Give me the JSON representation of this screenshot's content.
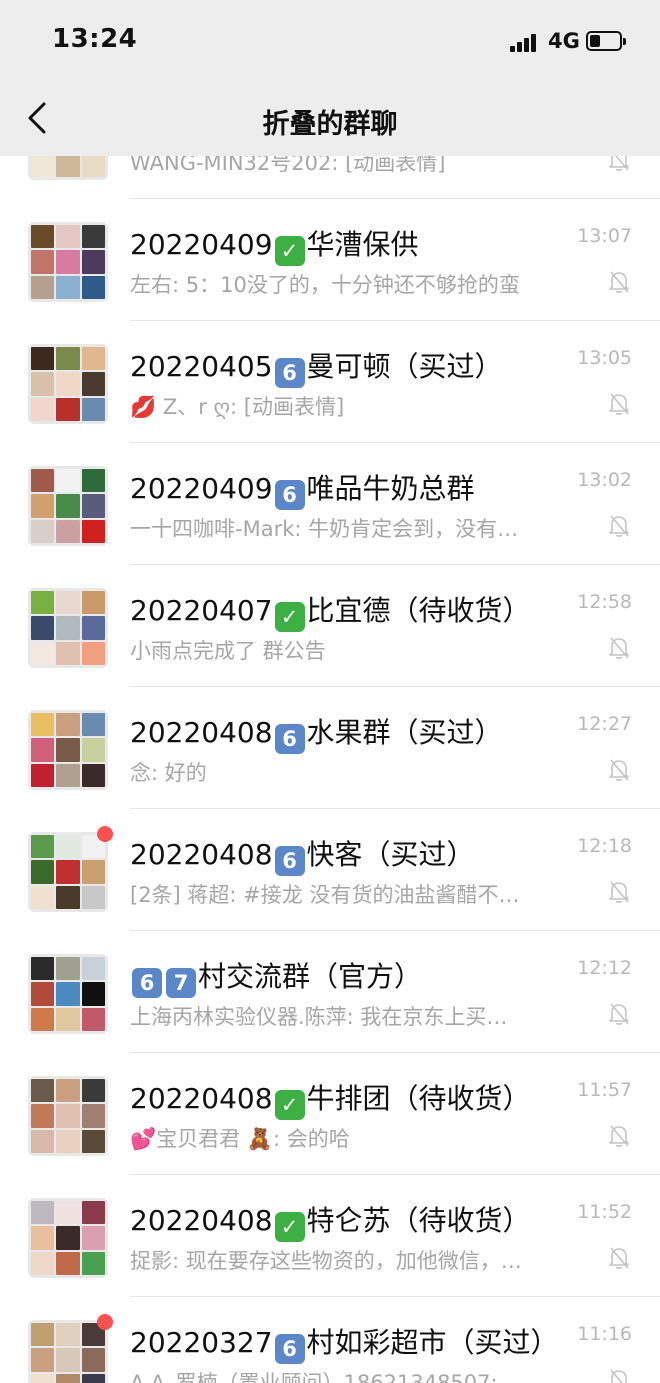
{
  "status_bar": {
    "time": "13:24",
    "network": "4G",
    "battery_level": 0.35
  },
  "nav": {
    "title": "折叠的群聊",
    "back_icon": "chevron-left-icon"
  },
  "colors": {
    "background": "#ffffff",
    "header": "#ededed",
    "check_badge": "#3cb043",
    "number_badge": "#5b86c8",
    "unread_dot": "#fa5151"
  },
  "chats": [
    {
      "title_pre": "",
      "badges": [],
      "title_post": "",
      "preview": "WANG-MIN32号202: [动画表情]",
      "time": "",
      "muted": true,
      "unread": false,
      "avatar_colors": [
        "#c9b89a",
        "#8a6a4a",
        "#d8a860",
        "#e2d4bf",
        "#b98756",
        "#ddbf8a",
        "#efe6d6",
        "#cdb89a",
        "#e8dcc5"
      ]
    },
    {
      "title_pre": "20220409",
      "badges": [
        "✓"
      ],
      "title_post": "华漕保供",
      "preview": "左右: 5：10没了的，十分钟还不够抢的蛮",
      "time": "13:07",
      "muted": true,
      "unread": false,
      "avatar_colors": [
        "#6b4a2a",
        "#e6c6c0",
        "#3a3a3a",
        "#c0746a",
        "#d67ca0",
        "#4b3b5c",
        "#b5a08d",
        "#8bb0d0",
        "#2d5c8a"
      ]
    },
    {
      "title_pre": "20220405",
      "badges": [
        "6"
      ],
      "title_post": "曼可顿（买过）",
      "preview": "💋 Z、r ღ: [动画表情]",
      "time": "13:05",
      "muted": true,
      "unread": false,
      "avatar_colors": [
        "#3d2a1e",
        "#7a8a4a",
        "#e0b890",
        "#d9c0a8",
        "#f0d8c8",
        "#4a3a30",
        "#f2d6cc",
        "#b8302a",
        "#6a8ab0"
      ]
    },
    {
      "title_pre": "20220409",
      "badges": [
        "6"
      ],
      "title_post": "唯品牛奶总群",
      "preview": "一十四咖啡-Mark: 牛奶肯定会到，没有…",
      "time": "13:02",
      "muted": true,
      "unread": false,
      "avatar_colors": [
        "#a05a4a",
        "#f2f2f2",
        "#2f6a3a",
        "#d0a070",
        "#4a8a4a",
        "#5a5a7a",
        "#d8d0c8",
        "#caa0a0",
        "#d02020"
      ]
    },
    {
      "title_pre": "20220407",
      "badges": [
        "✓"
      ],
      "title_post": "比宜德（待收货）",
      "preview": "小雨点完成了 群公告",
      "time": "12:58",
      "muted": true,
      "unread": false,
      "avatar_colors": [
        "#7ab040",
        "#e8d8d0",
        "#c89a6a",
        "#3a4a6a",
        "#b0b8c0",
        "#5a6a9a",
        "#f2e8e0",
        "#e0c0b0",
        "#f0a080"
      ]
    },
    {
      "title_pre": "20220408",
      "badges": [
        "6"
      ],
      "title_post": "水果群（买过）",
      "preview": "念: 好的",
      "time": "12:27",
      "muted": true,
      "unread": false,
      "avatar_colors": [
        "#e8c060",
        "#caa080",
        "#6a8ab0",
        "#d0607a",
        "#7a5a4a",
        "#c8d0a0",
        "#c02030",
        "#b0a090",
        "#3a2a2a"
      ]
    },
    {
      "title_pre": "20220408",
      "badges": [
        "6"
      ],
      "title_post": "快客（买过）",
      "preview": "[2条] 蒋超: #接龙 没有货的油盐酱醋不…",
      "time": "12:18",
      "muted": true,
      "unread": true,
      "avatar_colors": [
        "#5a9a4a",
        "#e0e8e0",
        "#f2f2f2",
        "#3a6a2a",
        "#c03030",
        "#caa070",
        "#f0e0d0",
        "#4a3a2a",
        "#c8c8c8"
      ]
    },
    {
      "title_pre": "",
      "badges": [
        "6",
        "7"
      ],
      "title_post": "村交流群（官方）",
      "preview": "上海丙林实验仪器.陈萍: 我在京东上买…",
      "time": "12:12",
      "muted": true,
      "unread": false,
      "avatar_colors": [
        "#2a2a2a",
        "#a0a090",
        "#c8d0d8",
        "#b04a3a",
        "#4a8ac0",
        "#101010",
        "#d07a4a",
        "#e0c8a0",
        "#c05a6a"
      ]
    },
    {
      "title_pre": "20220408",
      "badges": [
        "✓"
      ],
      "title_post": "牛排团（待收货）",
      "preview": "💕宝贝君君 🧸: 会的哈",
      "time": "11:57",
      "muted": true,
      "unread": false,
      "avatar_colors": [
        "#6a5a4a",
        "#caa080",
        "#3a3a3a",
        "#c07a5a",
        "#e0c0b0",
        "#a08070",
        "#d8b8a8",
        "#e8d0c0",
        "#5a4a3a"
      ]
    },
    {
      "title_pre": "20220408",
      "badges": [
        "✓"
      ],
      "title_post": "特仑苏（待收货）",
      "preview": "捉影: 现在要存这些物资的，加他微信，…",
      "time": "11:52",
      "muted": true,
      "unread": false,
      "avatar_colors": [
        "#c0b8c0",
        "#f0e0e0",
        "#8a3a4a",
        "#e8c0a0",
        "#3a2a2a",
        "#d8a0b0",
        "#f0d8c8",
        "#c06a4a",
        "#4aa050"
      ]
    },
    {
      "title_pre": "20220327",
      "badges": [
        "6"
      ],
      "title_post": "村如彩超市（买过）",
      "preview": "A.A_罗楠（置业顾问）18621348507:",
      "time": "11:16",
      "muted": true,
      "unread": true,
      "avatar_colors": [
        "#c0a070",
        "#e0d0c0",
        "#4a3a3a",
        "#caa080",
        "#d8c8b8",
        "#8a6a5a",
        "#f0e0d0",
        "#b08a6a",
        "#3a3a4a"
      ]
    }
  ]
}
